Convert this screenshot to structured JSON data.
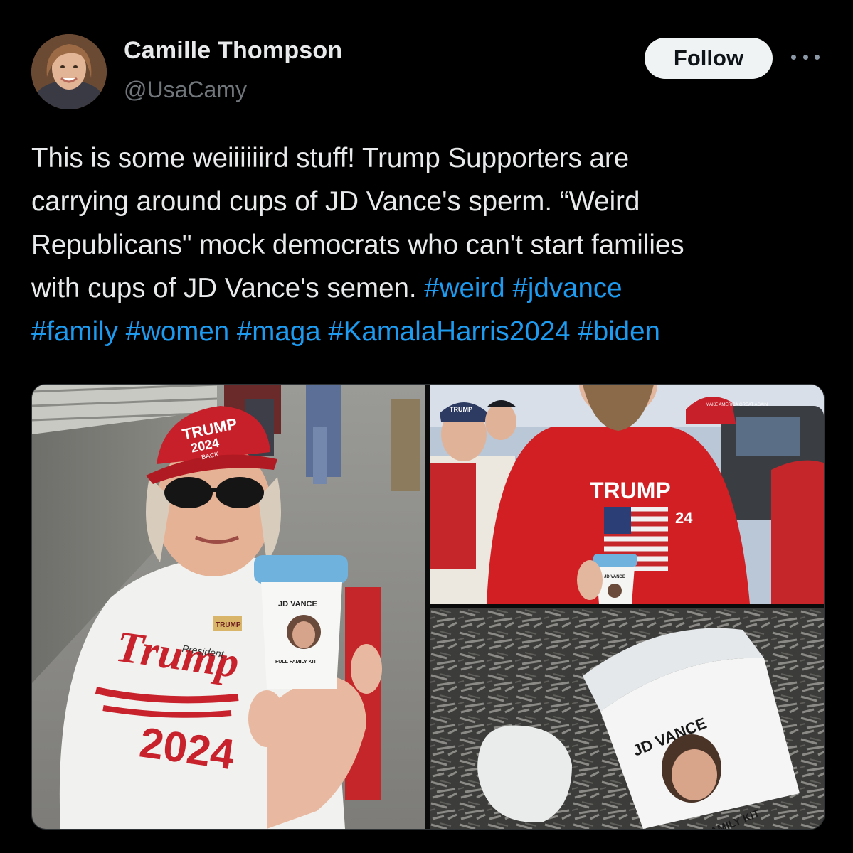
{
  "author": {
    "display_name": "Camille Thompson",
    "handle": "@UsaCamy",
    "avatar_icon": "user-avatar-photo"
  },
  "actions": {
    "follow_label": "Follow",
    "more_icon": "more-horizontal-icon"
  },
  "tweet": {
    "lines": [
      [
        {
          "t": "This is some weiiiiiird stuff! Trump Supporters are",
          "h": false
        }
      ],
      [
        {
          "t": "carrying around cups of JD Vance's sperm. “Weird",
          "h": false
        }
      ],
      [
        {
          "t": "Republicans\" mock democrats who can't start families",
          "h": false
        }
      ],
      [
        {
          "t": "with cups of JD Vance's semen. ",
          "h": false
        },
        {
          "t": "#weird",
          "h": true
        },
        {
          "t": " ",
          "h": false
        },
        {
          "t": "#jdvance",
          "h": true
        }
      ],
      [
        {
          "t": "#family",
          "h": true
        },
        {
          "t": " ",
          "h": false
        },
        {
          "t": "#women",
          "h": true
        },
        {
          "t": " ",
          "h": false
        },
        {
          "t": "#maga",
          "h": true
        },
        {
          "t": " ",
          "h": false
        },
        {
          "t": "#KamalaHarris2024",
          "h": true
        },
        {
          "t": " ",
          "h": false
        },
        {
          "t": "#biden",
          "h": true
        }
      ]
    ],
    "hashtag_color": "#1d9bf0"
  },
  "media": {
    "photos": [
      {
        "description_icon": "photo-woman-holding-cup",
        "hat_text_1": "TRUMP",
        "hat_text_2": "2024",
        "hat_text_3": "BACK",
        "cup_label_top": "JD VANCE",
        "cup_label_bottom": "FULL FAMILY KIT",
        "shirt_text_1": "Trump",
        "shirt_text_2": "President",
        "shirt_text_3": "2024",
        "pin_text": "TRUMP"
      },
      {
        "description_icon": "photo-man-in-trump-shirt",
        "hat_text_left": "TRUMP",
        "hat_text_right": "MAKE AMERICA GREAT AGAIN",
        "shirt_text_1": "TRUMP",
        "shirt_text_2": "24",
        "cup_label": "JD VANCE"
      },
      {
        "description_icon": "photo-cup-on-mulch",
        "cup_label_top": "JD VANCE",
        "cup_label_bottom": "FAMILY KIT"
      }
    ]
  }
}
